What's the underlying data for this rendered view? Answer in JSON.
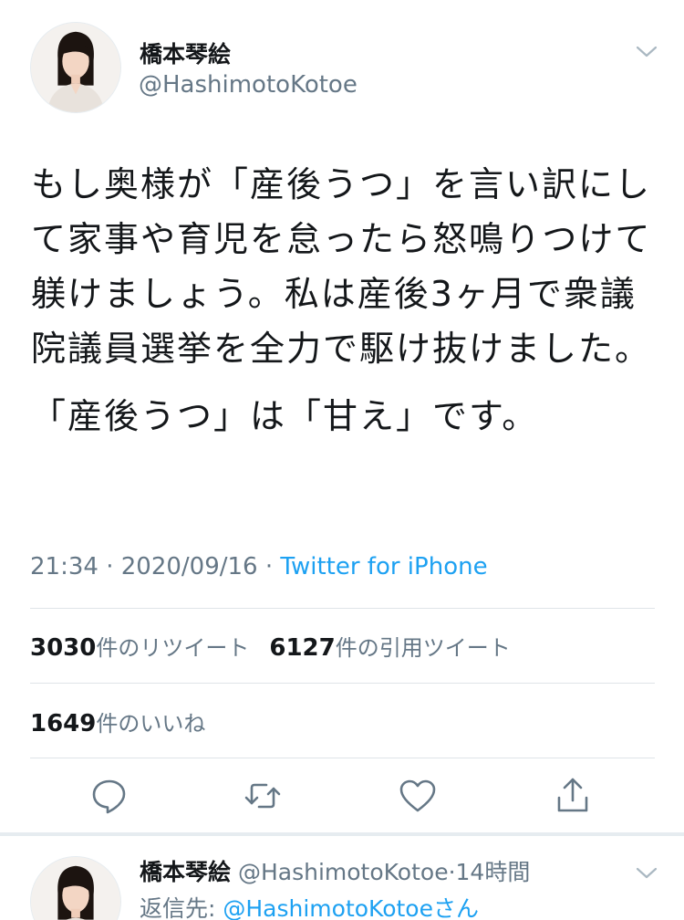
{
  "tweet": {
    "display_name": "橋本琴絵",
    "handle": "@HashimotoKotoe",
    "text_para1": "もし奥様が「産後うつ」を言い訳にして家事や育児を怠ったら怒鳴りつけて躾けましょう。私は産後3ヶ月で衆議院議員選挙を全力で駆け抜けました。",
    "text_para2": "「産後うつ」は「甘え」です。",
    "time": "21:34",
    "date": "2020/09/16",
    "meta_sep": "·",
    "source": "Twitter for iPhone"
  },
  "stats": {
    "retweets_count": "3030",
    "retweets_label": "件のリツイート",
    "quotes_count": "6127",
    "quotes_label": "件の引用ツイート",
    "likes_count": "1649",
    "likes_label": "件のいいね"
  },
  "actions": {
    "reply_icon": "reply-icon",
    "retweet_icon": "retweet-icon",
    "like_icon": "heart-icon",
    "share_icon": "share-icon"
  },
  "reply": {
    "display_name": "橋本琴絵",
    "handle": "@HashimotoKotoe",
    "sep": "·",
    "time_ago": "14時間",
    "reply_to_label": "返信先: ",
    "reply_to_handle": "@HashimotoKotoe",
    "reply_to_suffix": "さん"
  },
  "colors": {
    "text": "#14171a",
    "secondary": "#657786",
    "accent": "#1da1f2",
    "divider": "#dfe4e8"
  }
}
